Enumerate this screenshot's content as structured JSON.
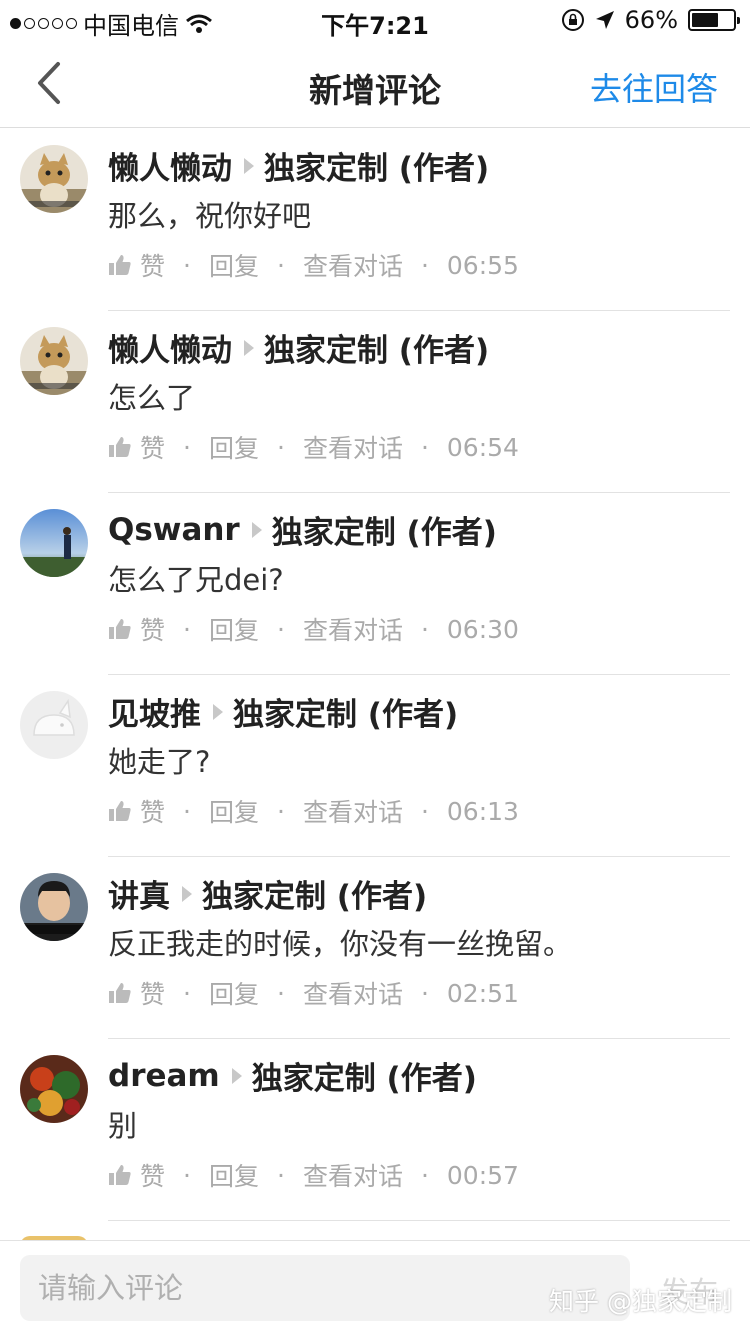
{
  "status_bar": {
    "carrier": "中国电信",
    "time": "下午7:21",
    "battery_percent": "66%",
    "battery_level": 0.66,
    "signal_bars_filled": 1,
    "signal_bars_total": 5
  },
  "nav": {
    "title": "新增评论",
    "action": "去往回答"
  },
  "labels": {
    "like": "赞",
    "reply": "回复",
    "view_conversation": "查看对话",
    "separator": "·"
  },
  "comments": [
    {
      "author": "懒人懒动",
      "target": "独家定制 (作者)",
      "text": "那么，祝你好吧",
      "time": "06:55",
      "avatar": "cat-avatar"
    },
    {
      "author": "懒人懒动",
      "target": "独家定制 (作者)",
      "text": "怎么了",
      "time": "06:54",
      "avatar": "cat-avatar"
    },
    {
      "author": "Qswanr",
      "target": "独家定制 (作者)",
      "text": "怎么了兄dei?",
      "time": "06:30",
      "avatar": "sky-avatar"
    },
    {
      "author": "见坡推",
      "target": "独家定制 (作者)",
      "text": "她走了?",
      "time": "06:13",
      "avatar": "default-avatar"
    },
    {
      "author": "讲真",
      "target": "独家定制 (作者)",
      "text": "反正我走的时候，你没有一丝挽留。",
      "time": "02:51",
      "avatar": "man-avatar"
    },
    {
      "author": "dream",
      "target": "独家定制 (作者)",
      "text": "别",
      "time": "00:57",
      "avatar": "food-avatar"
    }
  ],
  "composer": {
    "placeholder": "请输入评论",
    "send_label": "发布"
  },
  "watermark": "知乎 @独家定制",
  "colors": {
    "accent": "#1e8ae8",
    "meta_text": "#aaaaaa",
    "separator": "#e2e2e2"
  }
}
